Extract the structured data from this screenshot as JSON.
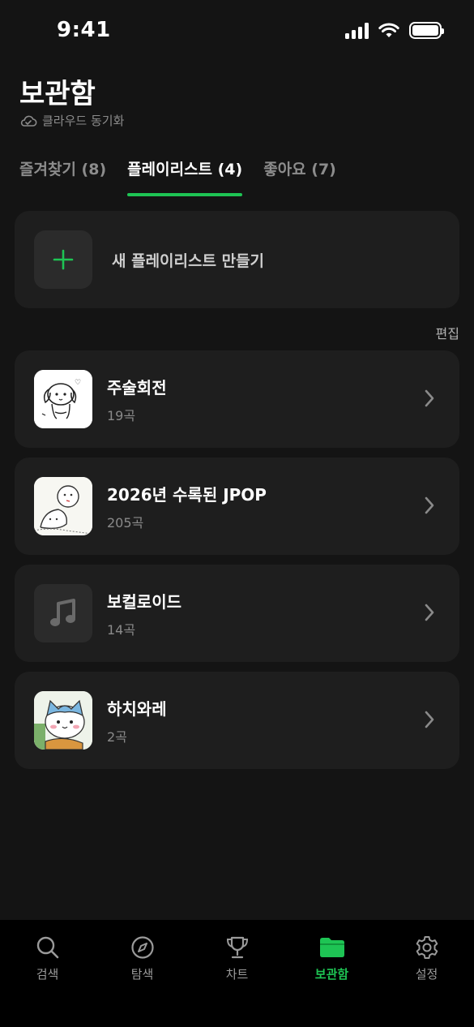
{
  "status_bar": {
    "time": "9:41"
  },
  "header": {
    "title": "보관함",
    "sync_label": "클라우드 동기화"
  },
  "tabs": [
    {
      "label": "즐겨찾기 (8)",
      "active": false
    },
    {
      "label": "플레이리스트 (4)",
      "active": true
    },
    {
      "label": "좋아요 (7)",
      "active": false
    }
  ],
  "create_playlist": {
    "label": "새 플레이리스트 만들기"
  },
  "edit_label": "편집",
  "playlists": [
    {
      "name": "주술회전",
      "count": "19곡",
      "thumb": "dog-sketch-image"
    },
    {
      "name": "2026년 수록된 JPOP",
      "count": "205곡",
      "thumb": "cartoon-sketch-image"
    },
    {
      "name": "보컬로이드",
      "count": "14곡",
      "thumb": "music-note-icon"
    },
    {
      "name": "하치와레",
      "count": "2곡",
      "thumb": "hachiware-image"
    }
  ],
  "nav": [
    {
      "label": "검색",
      "icon": "search-icon",
      "active": false
    },
    {
      "label": "탐색",
      "icon": "compass-icon",
      "active": false
    },
    {
      "label": "차트",
      "icon": "trophy-icon",
      "active": false
    },
    {
      "label": "보관함",
      "icon": "folder-icon",
      "active": true
    },
    {
      "label": "설정",
      "icon": "gear-icon",
      "active": false
    }
  ],
  "colors": {
    "accent": "#1ec454",
    "background": "#141414",
    "card": "#1e1e1e"
  }
}
